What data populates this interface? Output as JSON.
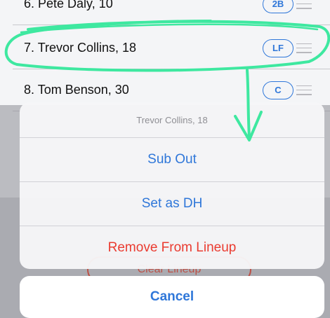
{
  "lineup": {
    "rows": [
      {
        "label": "6. Pete Daly, 10",
        "pos": "2B"
      },
      {
        "label": "7. Trevor Collins, 18",
        "pos": "LF"
      },
      {
        "label": "8. Tom Benson, 30",
        "pos": "C"
      }
    ],
    "clear_label": "Clear Lineup"
  },
  "action_sheet": {
    "title": "Trevor Collins, 18",
    "actions": [
      {
        "label": "Sub Out",
        "style": "default"
      },
      {
        "label": "Set as DH",
        "style": "default"
      },
      {
        "label": "Remove From Lineup",
        "style": "destructive"
      }
    ],
    "cancel_label": "Cancel"
  },
  "colors": {
    "accent": "#2f77d9",
    "destructive": "#ea3b30",
    "annotation": "#3ee8a0"
  },
  "icons": {
    "reorder": "reorder-handle-icon",
    "annotation_arrow": "down-arrow-icon"
  }
}
